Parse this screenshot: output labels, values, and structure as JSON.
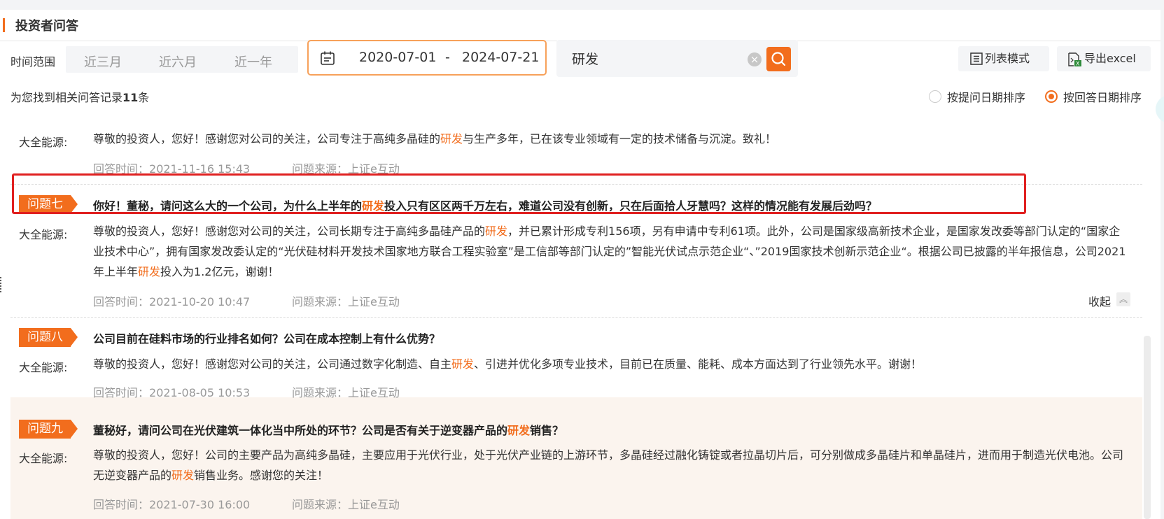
{
  "panel": {
    "title": "投资者问答"
  },
  "filters": {
    "time_label": "时间范围",
    "ranges": [
      "近三月",
      "近六月",
      "近一年"
    ],
    "date_start": "2020-07-01",
    "date_sep": "-",
    "date_end": "2024-07-21",
    "keyword": "研发",
    "list_mode_label": "列表模式",
    "export_label": "导出excel"
  },
  "results": {
    "prefix": "为您找到相关问答记录",
    "count": "11",
    "suffix": "条",
    "sort_by_question": "按提问日期排序",
    "sort_by_answer": "按回答日期排序",
    "sort_selected": "按回答日期排序"
  },
  "labels": {
    "answer_time_prefix": "回答时间：",
    "source_prefix": "问题来源：",
    "collapse": "收起"
  },
  "colors": {
    "accent": "#f26d1d",
    "highlight_box": "#e02020"
  },
  "items": [
    {
      "responder": "大全能源:",
      "answer": [
        "尊敬的投资人，您好！感谢您对公司的关注，公司专注于高纯多晶硅的",
        "研发",
        "与生产多年，已在该专业领域有一定的技术储备与沉淀。致礼！"
      ],
      "answer_time": "2021-11-16 15:43",
      "source": "上证e互动"
    },
    {
      "tag": "问题七",
      "question": [
        "你好！董秘，请问这么大的一个公司，为什么上半年的",
        "研发",
        "投入只有区区两千万左右，难道公司没有创新，只在后面拾人牙慧吗？这样的情况能有发展后劲吗？"
      ],
      "responder": "大全能源:",
      "answer": [
        "尊敬的投资人，您好！感谢您对公司的关注，公司长期专注于高纯多晶硅产品的",
        "研发",
        "，并已累计形成专利156项，另有申请中专利61项。此外，公司是国家级高新技术企业，是国家发改委等部门认定的“国家企业技术中心”，拥有国家发改委认定的“光伏硅材料开发技术国家地方联合工程实验室”是工信部等部门认定的”智能光伏试点示范企业“、”2019国家技术创新示范企业“。根据公司已披露的半年报信息，公司2021年上半年",
        "研发",
        "投入为1.2亿元，谢谢！"
      ],
      "answer_time": "2021-10-20 10:47",
      "source": "上证e互动"
    },
    {
      "tag": "问题八",
      "question": [
        "公司目前在硅料市场的行业排名如何？公司在成本控制上有什么优势？"
      ],
      "responder": "大全能源:",
      "answer": [
        "尊敬的投资人，您好！感谢您对公司的关注，公司通过数字化制造、自主",
        "研发",
        "、引进并优化多项专业技术，目前已在质量、能耗、成本方面达到了行业领先水平。谢谢！"
      ],
      "answer_time": "2021-08-05 10:53",
      "source": "上证e互动"
    },
    {
      "tag": "问题九",
      "question": [
        "董秘好，请问公司在光伏建筑一体化当中所处的环节？公司是否有关于逆变器产品的",
        "研发",
        "销售？"
      ],
      "responder": "大全能源:",
      "answer": [
        "尊敬的投资人，您好！公司的主要产品为高纯多晶硅，主要应用于光伏行业，处于光伏产业链的上游环节，多晶硅经过融化铸锭或者拉晶切片后，可分别做成多晶硅片和单晶硅片，进而用于制造光伏电池。公司无逆变器产品的",
        "研发",
        "销售业务。感谢您的关注！"
      ],
      "answer_time": "2021-07-30 16:00",
      "source": "上证e互动"
    }
  ]
}
